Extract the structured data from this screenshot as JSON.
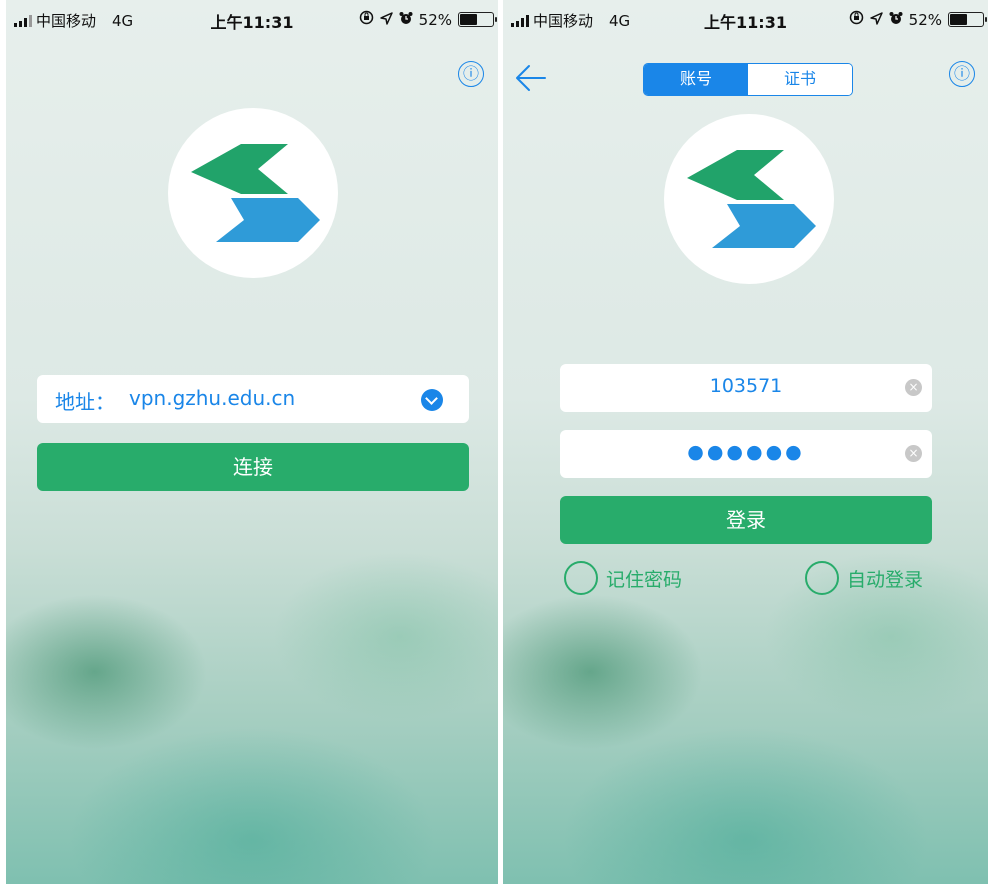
{
  "status_bar": {
    "carrier": "中国移动",
    "network": "4G",
    "time": "上午11:31",
    "battery": "52%",
    "battery_level": 0.52
  },
  "left_screen": {
    "info_icon": "ⓘ",
    "address": {
      "label": "地址：",
      "value": "vpn.gzhu.edu.cn"
    },
    "connect_label": "连接"
  },
  "right_screen": {
    "info_icon": "ⓘ",
    "tabs": [
      {
        "label": "账号",
        "active": true
      },
      {
        "label": "证书",
        "active": false
      }
    ],
    "username": "103571",
    "password": "●●●●●●",
    "login_label": "登录",
    "remember_label": "记住密码",
    "auto_login_label": "自动登录"
  },
  "colors": {
    "accent_blue": "#1a86e8",
    "accent_green": "#28ac6b",
    "logo_green": "#21a36a",
    "logo_blue": "#2f9bd8"
  },
  "icons": [
    "signal-icon",
    "orientation-lock-icon",
    "location-icon",
    "alarm-icon",
    "battery-icon",
    "info-icon",
    "dropdown-icon",
    "back-arrow-icon",
    "clear-icon",
    "radio-icon"
  ]
}
